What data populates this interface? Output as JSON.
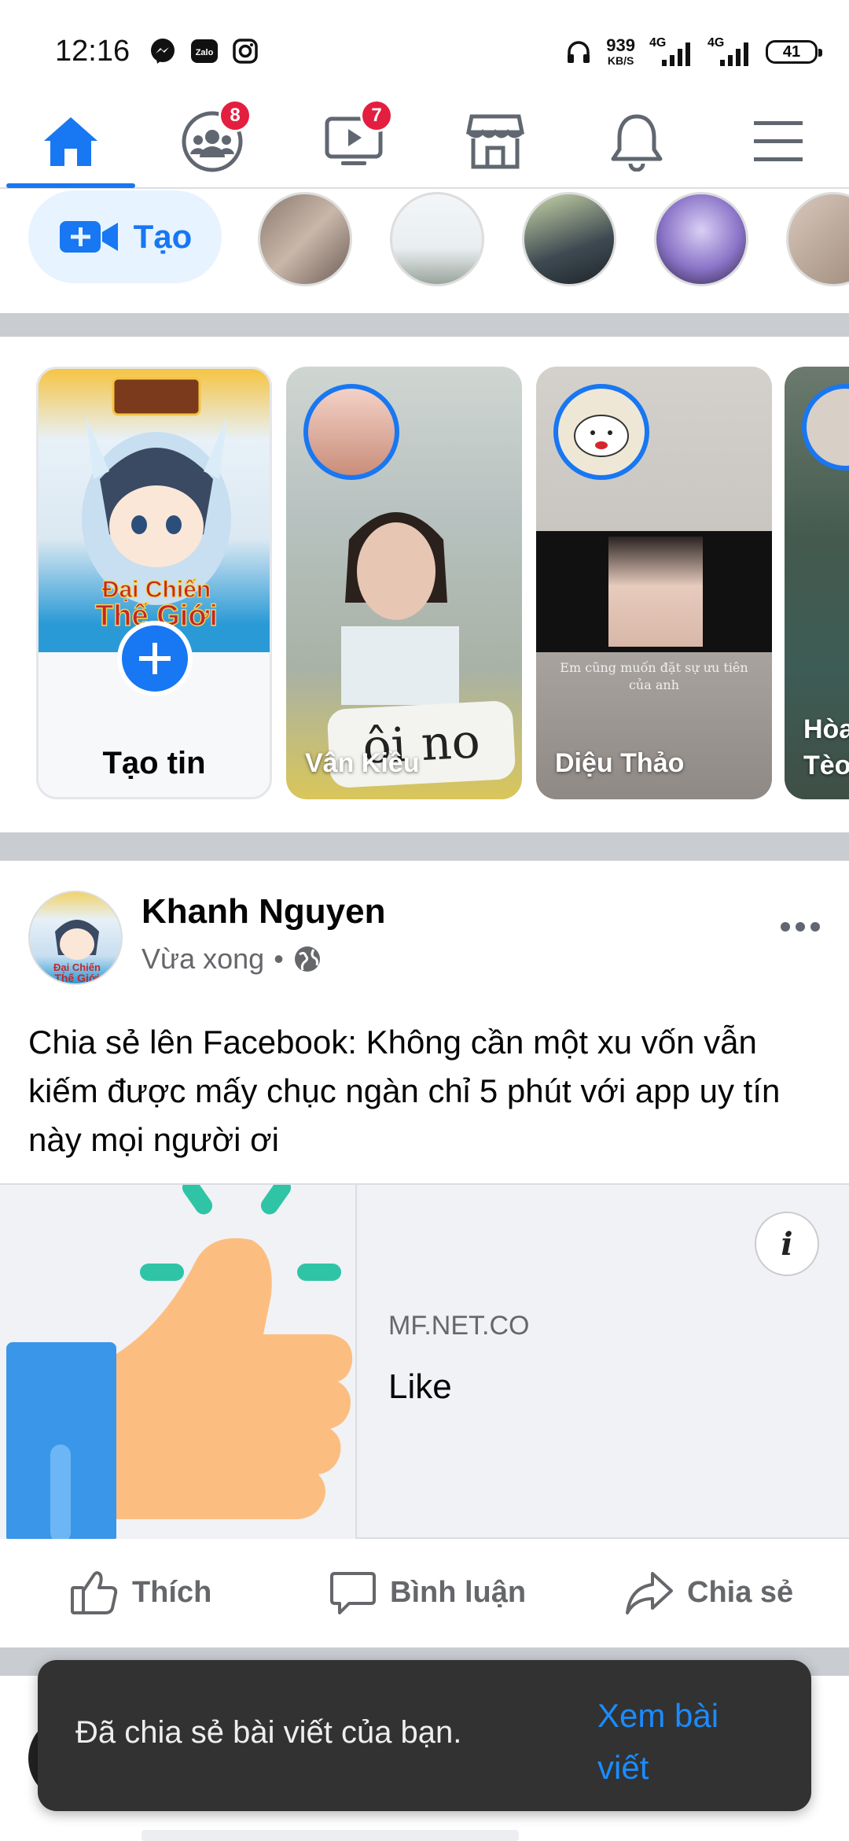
{
  "status_bar": {
    "time": "12:16",
    "net_speed_value": "939",
    "net_speed_unit": "KB/S",
    "net1": "4G",
    "net2": "4G",
    "battery": "41"
  },
  "nav": {
    "friends_badge": "8",
    "watch_badge": "7"
  },
  "create_button": {
    "label": "Tạo"
  },
  "stories": {
    "create_label": "Tạo tin",
    "items": [
      {
        "name": "Vân Kiều",
        "sticker_text": "ôi no"
      },
      {
        "name": "Diệu Thảo",
        "caption": "Em cũng muốn đặt sự ưu tiên của anh"
      },
      {
        "name_line1": "Hòa",
        "name_line2": "Tèo"
      }
    ]
  },
  "post": {
    "author": "Khanh Nguyen",
    "time": "Vừa xong",
    "dot": "•",
    "text": "Chia sẻ lên Facebook: Không cần một xu vốn vẫn kiếm được mấy chục ngàn chỉ 5 phút với app uy tín này mọi người ơi",
    "link_domain": "MF.NET.CO",
    "link_title": "Like",
    "info_label": "i"
  },
  "actions": {
    "like": "Thích",
    "comment": "Bình luận",
    "share": "Chia sẻ"
  },
  "snackbar": {
    "message": "Đã chia sẻ bài viết của bạn.",
    "action": "Xem bài viết"
  },
  "colors": {
    "brand_blue": "#1877f2",
    "badge_red": "#e41e3f",
    "snackbar_bg": "#323232",
    "snackbar_action": "#1a8cff"
  }
}
